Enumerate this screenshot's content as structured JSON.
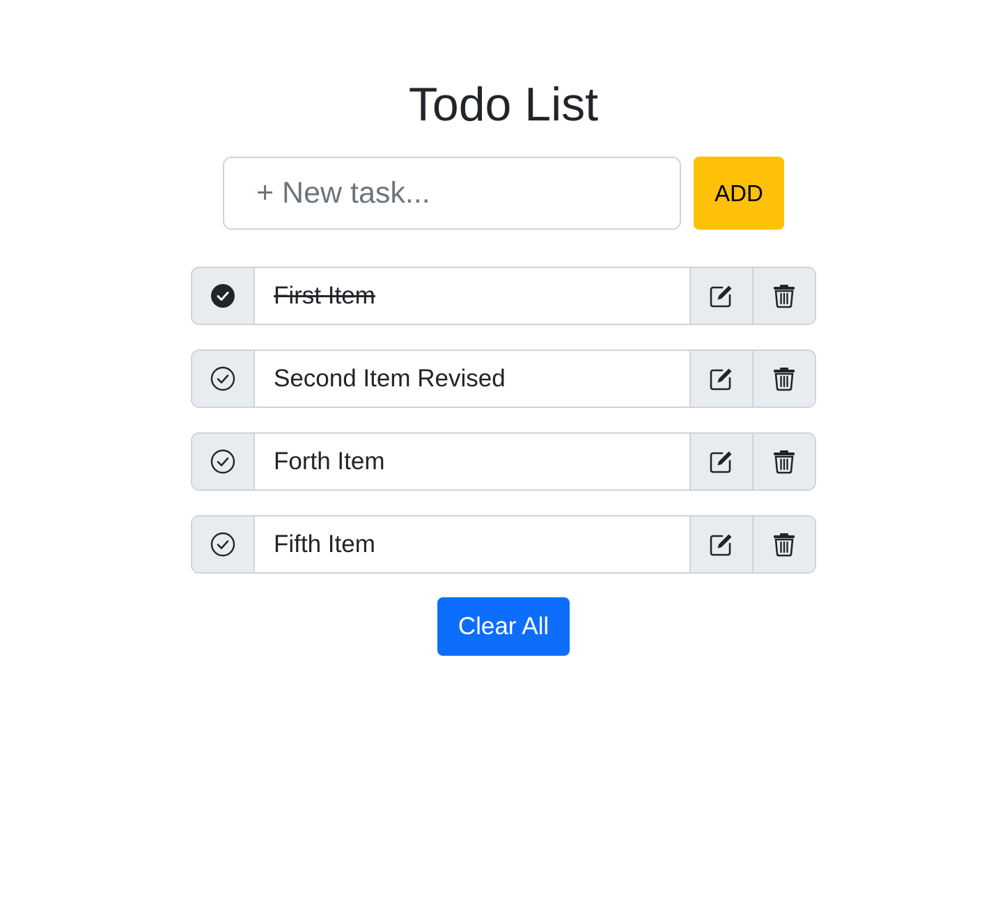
{
  "app": {
    "title": "Todo List"
  },
  "add_form": {
    "placeholder": "+ New task...",
    "value": "",
    "add_label": "ADD",
    "add_color": "#ffc107"
  },
  "todos": [
    {
      "text": "First Item",
      "completed": true,
      "toggle_icon": "check-circle-filled-icon",
      "edit_icon": "edit-icon",
      "delete_icon": "trash-icon"
    },
    {
      "text": "Second Item Revised",
      "completed": false,
      "toggle_icon": "check-circle-outline-icon",
      "edit_icon": "edit-icon",
      "delete_icon": "trash-icon"
    },
    {
      "text": "Forth Item",
      "completed": false,
      "toggle_icon": "check-circle-outline-icon",
      "edit_icon": "edit-icon",
      "delete_icon": "trash-icon"
    },
    {
      "text": "Fifth Item",
      "completed": false,
      "toggle_icon": "check-circle-outline-icon",
      "edit_icon": "edit-icon",
      "delete_icon": "trash-icon"
    }
  ],
  "footer": {
    "clear_label": "Clear All",
    "clear_color": "#0d6efd"
  }
}
